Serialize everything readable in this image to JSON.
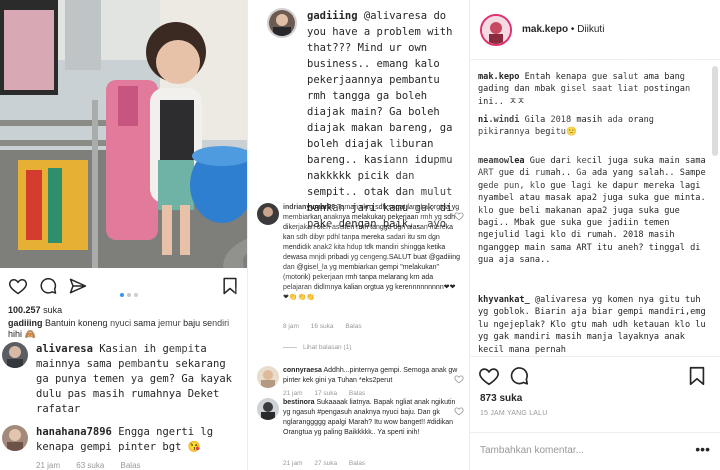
{
  "left": {
    "likes_count": "100.257",
    "likes_suffix": "suka",
    "caption_user": "gadiiing",
    "caption_text": "Bantuin koneng nyuci sama jemur baju sendiri hihi 🙈",
    "comments": [
      {
        "user": "alivaresa",
        "text": "Kasian ih gempita mainnya sama pembantu sekarang ga punya temen ya gem? Ga kayak dulu pas masih rumahnya Deket rafatar",
        "meta": []
      },
      {
        "user": "hanahana7896",
        "text": "Engga ngerti lg kenapa gempi pinter bgt 😘",
        "meta": [
          "21 jam",
          "63 suka",
          "Balas"
        ]
      }
    ]
  },
  "middle": {
    "main_user": "gadiiing",
    "main_text": "@alivaresa do you have a problem with that??? Mind ur own business.. emang kalo pekerjaannya pembantu rmh tangga ga boleh diajak main? Ga boleh diajak makan bareng, ga boleh diajak liburan bareng.. kasiann idupmu nakkkkk picik dan sempit.. otak dan mulut bahkan jari kamu gak di pake dengan baik.. ayo",
    "comments": [
      {
        "user": "indrianyumar08",
        "text": "Taman skrg sdh sngat langka orgtua yg membiarkan anaknya melakukan pekerjaan rmh yg sdh dikerjakan oleh asisten rmh tangga dgn alasan mereka kan sdh dibyr pdhl tanpa mereka sadari itu sm dgn mendidik anak2 kita hdup tdk mandiri shingga ketika dewasa mnjdi pribadi yg cengeng.SALUT buat @gadiiing dan @gisel_la yg membiarkan gempi \"melakukan\" (motorik) pekerjaan rmh tanpa melarang krn ada pelajaran didlmnya kalian orgtua yg kerennnnnnnnn❤❤❤👏👏👏",
        "meta": [
          "8 jam",
          "16 suka",
          "Balas"
        ]
      },
      {
        "user": "",
        "text": "Lihat balasan (1)",
        "meta": []
      },
      {
        "user": "connyraesa",
        "text": "Addhh...pinternya gempi. Semoga anak gw pinter kek gini ya Tuhan *eks2perut",
        "meta": [
          "21 jam",
          "17 suka",
          "Balas"
        ]
      },
      {
        "user": "bestinora",
        "text": "Sukaaaak liatnya. Bapak ngliat anak ngikutin yg ngasuh #pengasuh anaknya nyuci baju. Dan gk nglaranggggg apalgi Marah? Itu wow banget!! #didikan Orangtua yg paling Baikkkkk.. Ya sperti inih!",
        "meta": [
          "21 jam",
          "27 suka",
          "Balas"
        ]
      }
    ]
  },
  "right": {
    "header_user": "mak.kepo",
    "header_follow": "• Diikuti",
    "comments": [
      {
        "user": "mak.kepo",
        "text": "Entah kenapa gue salut ama bang gading dan mbak gisel saat liat postingan ini.. ㅈㅈ"
      },
      {
        "user": "ni.windi",
        "text": "Gila 2018 masih ada orang pikirannya begitu🙁"
      },
      {
        "user": "meamowlea",
        "text": "Gue dari kecil juga suka main sama ART gue di rumah.. Ga ada yang salah.. Sampe gede pun, klo gue lagi ke dapur mereka lagi nyambel atau masak apa2 juga suka gue minta. klo gue beli makanan apa2 juga suka gue bagi.. Mbak gue suka gue jadiin temen ngejulid lagi klo di rumah. 2018 masih nganggep main sama ART itu aneh? tinggal di gua aja sana.."
      },
      {
        "user": "khyvankat_",
        "text": "@alivaresa yg komen nya gitu tuh yg goblok. Biarin aja biar gempi mandiri,emg lu ngejeplak? Klo gtu mah udh ketauan klo lu yg gak mandiri masih manja layaknya anak kecil mana pernah"
      }
    ],
    "likes": "873 suka",
    "time": "15 JAM YANG LALU",
    "add_comment_placeholder": "Tambahkan komentar...",
    "more": "•••"
  },
  "watermark": "mak.kepo",
  "colors": {
    "link_blue": "#3897f0",
    "muted": "#999999",
    "text": "#262626",
    "border": "#efefef"
  }
}
